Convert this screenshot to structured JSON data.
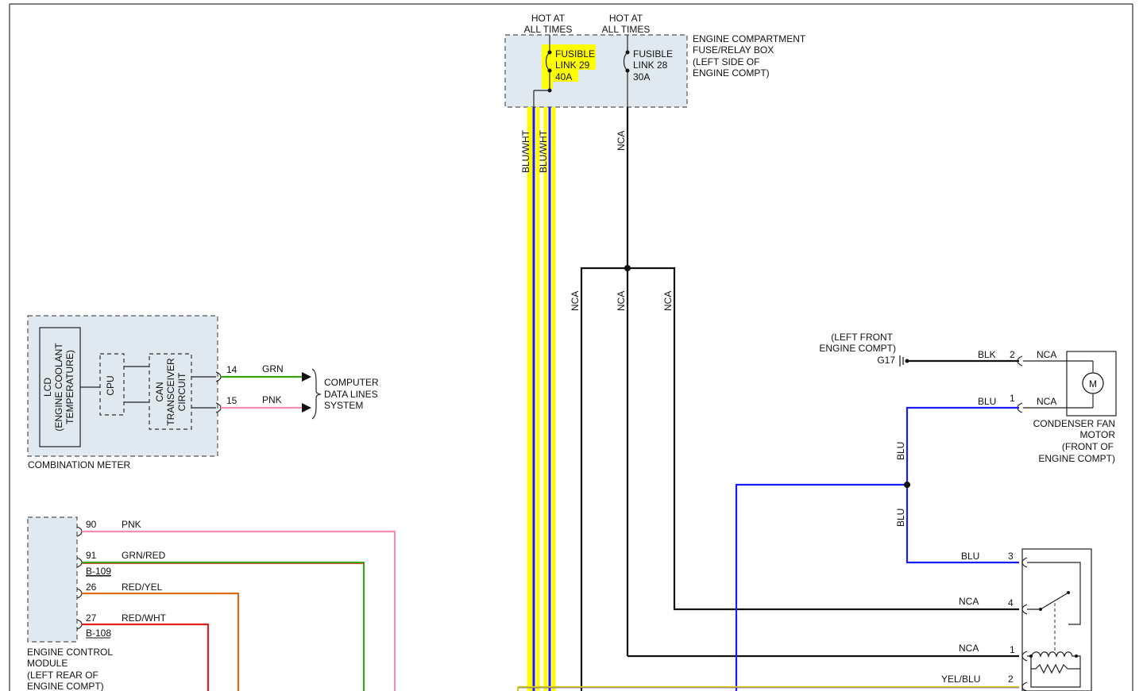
{
  "fuse_box": {
    "hot_1_a": "HOT AT",
    "hot_1_b": "ALL TIMES",
    "hot_2_a": "HOT AT",
    "hot_2_b": "ALL TIMES",
    "title_1": "ENGINE COMPARTMENT",
    "title_2": "FUSE/RELAY BOX",
    "title_3": "(LEFT SIDE OF",
    "title_4": "ENGINE COMPT)",
    "fl29_1": "FUSIBLE",
    "fl29_2": "LINK 29",
    "fl29_3": "40A",
    "fl28_1": "FUSIBLE",
    "fl28_2": "LINK 28",
    "fl28_3": "30A",
    "highlight_color": "#ffff00"
  },
  "wires": {
    "blu_wht_1": "BLU/WHT",
    "blu_wht_2": "BLU/WHT",
    "nca_top": "NCA",
    "nca_left": "NCA",
    "nca_mid": "NCA",
    "nca_right": "NCA",
    "blu_upper": "BLU",
    "blu_lower": "BLU"
  },
  "combination_meter": {
    "name": "COMBINATION METER",
    "lcd_1": "LCD",
    "lcd_2": "(ENGINE COOLANT",
    "lcd_3": "TEMPERATURE)",
    "cpu": "CPU",
    "can_1": "CAN",
    "can_2": "TRANSCEIVER",
    "can_3": "CIRCUIT",
    "pin_14": "14",
    "wire_14": "GRN",
    "pin_15": "15",
    "wire_15": "PNK",
    "dest_1": "COMPUTER",
    "dest_2": "DATA LINES",
    "dest_3": "SYSTEM"
  },
  "ecm": {
    "name_1": "ENGINE CONTROL",
    "name_2": "MODULE",
    "name_3": "(LEFT REAR OF",
    "name_4": "ENGINE COMPT)",
    "pin_90": "90",
    "wire_90": "PNK",
    "pin_91": "91",
    "wire_91": "GRN/RED",
    "conn_b109": "B-109",
    "pin_26": "26",
    "wire_26": "RED/YEL",
    "pin_27": "27",
    "wire_27": "RED/WHT",
    "conn_b108": "B-108"
  },
  "ground": {
    "loc_1": "(LEFT FRONT",
    "loc_2": "ENGINE COMPT)",
    "id": "G17"
  },
  "fan_motor": {
    "pin_2": "2",
    "wire_2": "BLK",
    "nca_2": "NCA",
    "pin_1": "1",
    "wire_1": "BLU",
    "nca_1": "NCA",
    "symbol": "M",
    "name_1": "CONDENSER FAN",
    "name_2": "MOTOR",
    "name_3": "(FRONT OF",
    "name_4": "ENGINE COMPT)"
  },
  "relay": {
    "pin_3": "3",
    "wire_3": "BLU",
    "pin_4": "4",
    "wire_4": "NCA",
    "pin_1": "1",
    "wire_1": "NCA",
    "pin_2": "2",
    "wire_2": "YEL/BLU"
  },
  "colors": {
    "blu": "#1a1aff",
    "yellow": "#ffff00",
    "pnk": "#f48fb1",
    "grn": "#3aa314",
    "red": "#e02020",
    "orange": "#e06a10",
    "black": "#111111"
  }
}
